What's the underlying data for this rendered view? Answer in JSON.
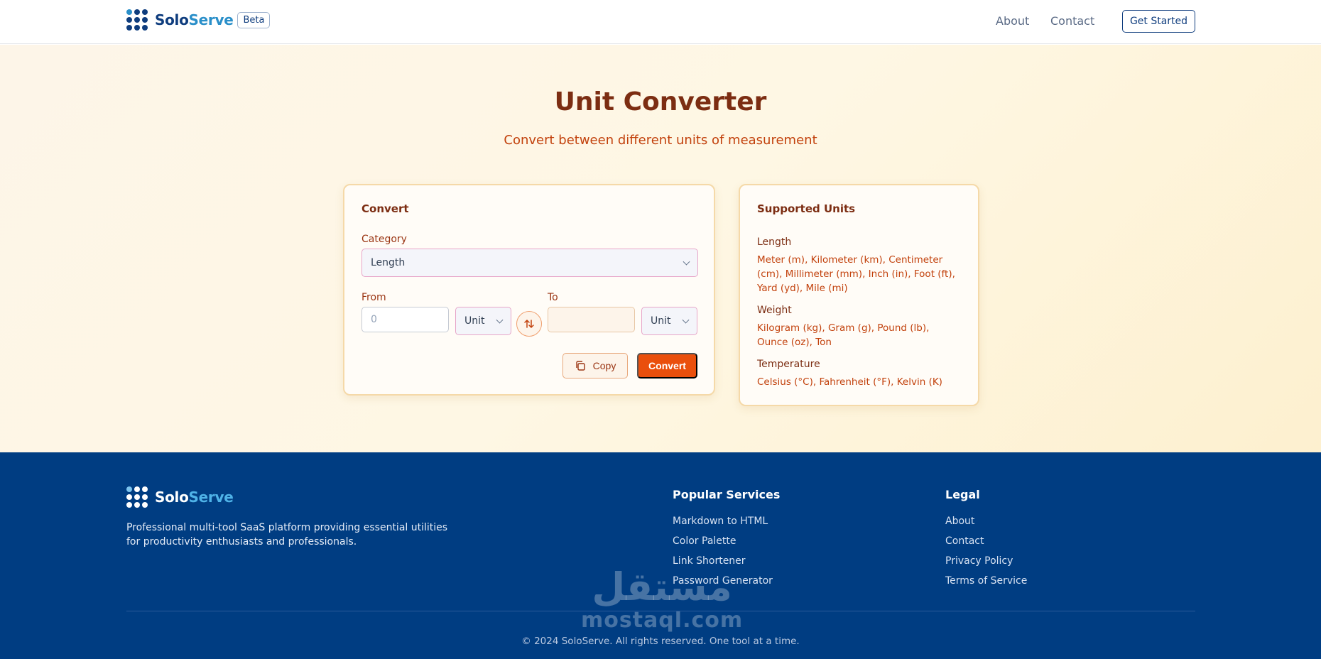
{
  "header": {
    "brand_solo": "Solo",
    "brand_serve": "Serve",
    "beta": "Beta",
    "nav": {
      "about": "About",
      "contact": "Contact"
    },
    "cta": "Get Started"
  },
  "hero": {
    "title": "Unit Converter",
    "subtitle": "Convert between different units of measurement"
  },
  "converter": {
    "title": "Convert",
    "category_label": "Category",
    "category_value": "Length",
    "from_label": "From",
    "from_placeholder": "0",
    "from_unit": "Unit",
    "to_label": "To",
    "to_value": "",
    "to_unit": "Unit",
    "copy_label": "Copy",
    "convert_label": "Convert"
  },
  "supported": {
    "title": "Supported Units",
    "groups": [
      {
        "name": "Length",
        "units": "Meter (m), Kilometer (km), Centimeter (cm), Millimeter (mm), Inch (in), Foot (ft), Yard (yd), Mile (mi)"
      },
      {
        "name": "Weight",
        "units": "Kilogram (kg), Gram (g), Pound (lb), Ounce (oz), Ton"
      },
      {
        "name": "Temperature",
        "units": "Celsius (°C), Fahrenheit (°F), Kelvin (K)"
      }
    ]
  },
  "footer": {
    "brand_solo": "Solo",
    "brand_serve": "Serve",
    "description": "Professional multi-tool SaaS platform providing essential utilities for productivity enthusiasts and professionals.",
    "popular": {
      "title": "Popular Services",
      "links": [
        "Markdown to HTML",
        "Color Palette",
        "Link Shortener",
        "Password Generator"
      ]
    },
    "legal": {
      "title": "Legal",
      "links": [
        "About",
        "Contact",
        "Privacy Policy",
        "Terms of Service"
      ]
    },
    "copyright": "© 2024 SoloServe. All rights reserved. One tool at a time.",
    "watermark_ar": "مستقل",
    "watermark_en": "mostaql.com"
  },
  "colors": {
    "brand_navy": "#0f3d7e",
    "brand_blue": "#2a8fc9",
    "accent_orange": "#ea4f0c",
    "footer_bg": "#003d82"
  },
  "icons": [
    "logo-dots-icon",
    "chevron-down-icon",
    "swap-icon",
    "copy-icon"
  ]
}
